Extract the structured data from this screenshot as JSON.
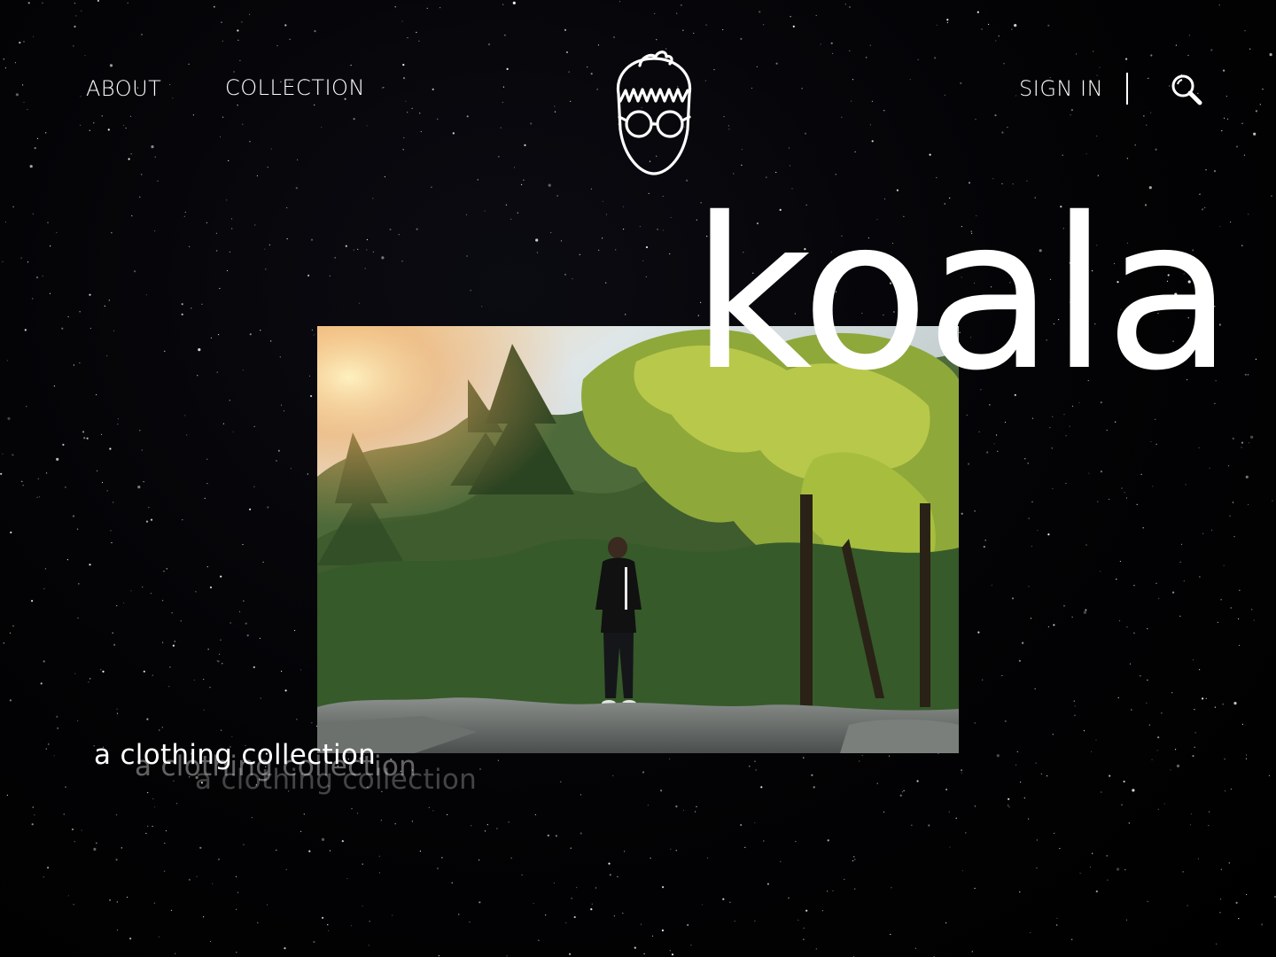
{
  "header": {
    "nav_left": [
      {
        "label": "ABOUT"
      },
      {
        "label": "COLLECTION"
      }
    ],
    "sign_in_label": "SIGN IN",
    "logo_icon": "nerd-face-with-glasses-logo-icon",
    "search_icon": "search-icon"
  },
  "hero": {
    "brand": "koala",
    "tagline": "a clothing collection",
    "photo": "person-standing-on-rocks-among-trees-photo"
  },
  "colors": {
    "background": "#000000",
    "text": "#ffffff"
  }
}
